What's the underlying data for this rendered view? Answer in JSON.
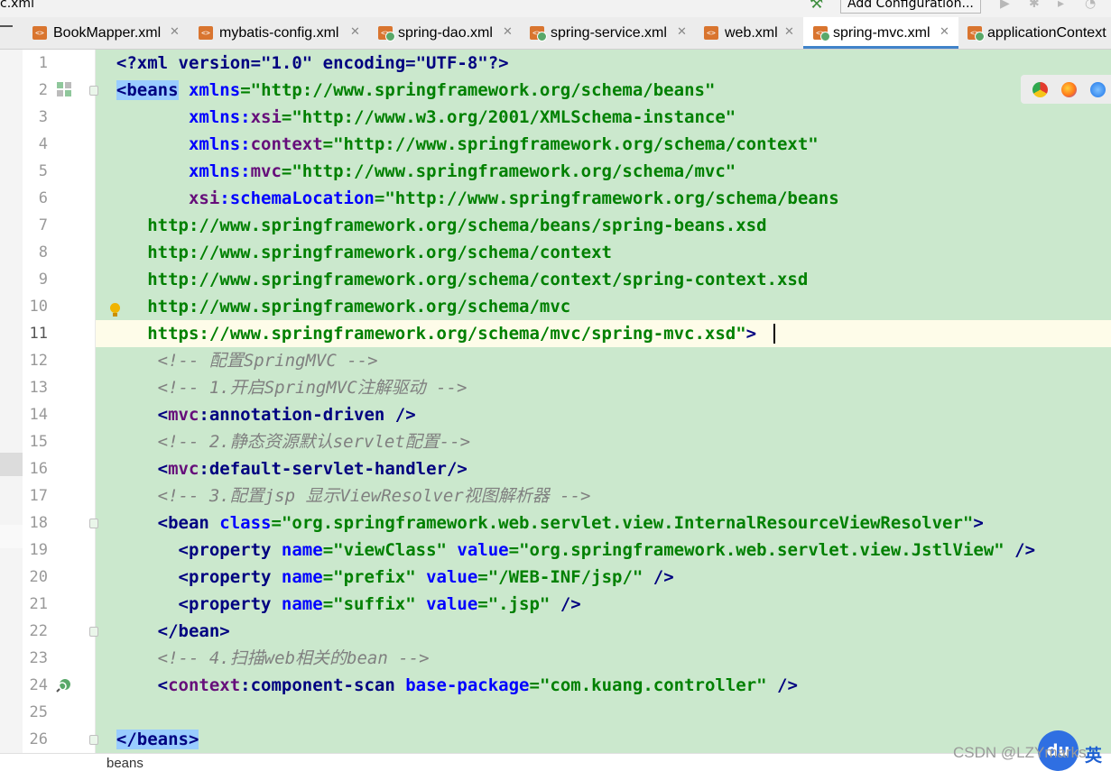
{
  "window": {
    "title_fragment": "c.xml"
  },
  "toolbar": {
    "add_configuration_label": "Add Configuration..."
  },
  "tabs": [
    {
      "label": "BookMapper.xml",
      "icon": "xml-file-icon",
      "active": false
    },
    {
      "label": "mybatis-config.xml",
      "icon": "xml-file-icon",
      "active": false
    },
    {
      "label": "spring-dao.xml",
      "icon": "spring-xml-file-icon",
      "active": false
    },
    {
      "label": "spring-service.xml",
      "icon": "spring-xml-file-icon",
      "active": false
    },
    {
      "label": "web.xml",
      "icon": "web-xml-file-icon",
      "active": false
    },
    {
      "label": "spring-mvc.xml",
      "icon": "spring-xml-file-icon",
      "active": true
    },
    {
      "label": "applicationContext",
      "icon": "spring-xml-file-icon",
      "active": false
    }
  ],
  "editor": {
    "current_line": 11,
    "lines": [
      {
        "n": "1"
      },
      {
        "n": "2"
      },
      {
        "n": "3"
      },
      {
        "n": "4"
      },
      {
        "n": "5"
      },
      {
        "n": "6"
      },
      {
        "n": "7"
      },
      {
        "n": "8"
      },
      {
        "n": "9"
      },
      {
        "n": "10"
      },
      {
        "n": "11"
      },
      {
        "n": "12"
      },
      {
        "n": "13"
      },
      {
        "n": "14"
      },
      {
        "n": "15"
      },
      {
        "n": "16"
      },
      {
        "n": "17"
      },
      {
        "n": "18"
      },
      {
        "n": "19"
      },
      {
        "n": "20"
      },
      {
        "n": "21"
      },
      {
        "n": "22"
      },
      {
        "n": "23"
      },
      {
        "n": "24"
      },
      {
        "n": "25"
      },
      {
        "n": "26"
      }
    ],
    "code": {
      "l1_decl": "<?xml version=\"1.0\" encoding=\"UTF-8\"?>",
      "l2_tag": "<beans",
      "l2_attr": "xmlns",
      "l2_val": "=\"http://www.springframework.org/schema/beans\"",
      "l3_attr": "xmlns:",
      "l3_ns": "xsi",
      "l3_val": "=\"http://www.w3.org/2001/XMLSchema-instance\"",
      "l4_attr": "xmlns:",
      "l4_ns": "context",
      "l4_val": "=\"http://www.springframework.org/schema/context\"",
      "l5_attr": "xmlns:",
      "l5_ns": "mvc",
      "l5_val": "=\"http://www.springframework.org/schema/mvc\"",
      "l6_ns": "xsi",
      "l6_attr": ":schemaLocation",
      "l6_val": "=\"http://www.springframework.org/schema/beans",
      "l7": "http://www.springframework.org/schema/beans/spring-beans.xsd",
      "l8": "http://www.springframework.org/schema/context",
      "l9": "http://www.springframework.org/schema/context/spring-context.xsd",
      "l10": "http://www.springframework.org/schema/mvc",
      "l11_val": "https://www.springframework.org/schema/mvc/spring-mvc.xsd\"",
      "l11_end": ">",
      "l12": "<!-- 配置SpringMVC -->",
      "l13": "<!-- 1.开启SpringMVC注解驱动 -->",
      "l14_open": "<",
      "l14_ns": "mvc",
      "l14_tag": ":annotation-driven />",
      "l15": "<!-- 2.静态资源默认servlet配置-->",
      "l16_open": "<",
      "l16_ns": "mvc",
      "l16_tag": ":default-servlet-handler/>",
      "l17": "<!-- 3.配置jsp 显示ViewResolver视图解析器 -->",
      "l18_tag": "<bean",
      "l18_attr": "class",
      "l18_val": "=\"org.springframework.web.servlet.view.InternalResourceViewResolver\"",
      "l18_end": ">",
      "l19_tag": "<property",
      "l19_a1": "name",
      "l19_v1": "=\"viewClass\"",
      "l19_a2": "value",
      "l19_v2": "=\"org.springframework.web.servlet.view.JstlView\"",
      "l19_end": " />",
      "l20_tag": "<property",
      "l20_a1": "name",
      "l20_v1": "=\"prefix\"",
      "l20_a2": "value",
      "l20_v2": "=\"/WEB-INF/jsp/\"",
      "l20_end": " />",
      "l21_tag": "<property",
      "l21_a1": "name",
      "l21_v1": "=\"suffix\"",
      "l21_a2": "value",
      "l21_v2": "=\".jsp\"",
      "l21_end": " />",
      "l22": "</bean>",
      "l23": "<!-- 4.扫描web相关的bean -->",
      "l24_open": "<",
      "l24_ns": "context",
      "l24_tag": ":component-scan",
      "l24_attr": "base-package",
      "l24_val": "=\"com.kuang.controller\"",
      "l24_end": " />",
      "l26": "</beans>"
    }
  },
  "breadcrumb": "beans",
  "watermark": "CSDN @LZYmarks",
  "ime": {
    "badge": "du",
    "label": "英"
  },
  "colors": {
    "code_bg": "#cbe8cd",
    "current_line": "#fefce9",
    "tag": "#000080",
    "attribute": "#0000ff",
    "namespace": "#660e7a",
    "string": "#008000",
    "comment": "#808080"
  }
}
